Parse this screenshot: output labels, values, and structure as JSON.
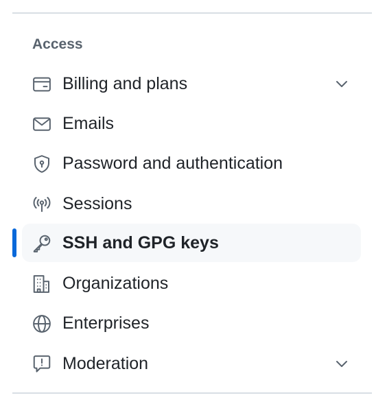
{
  "section": {
    "heading": "Access"
  },
  "nav": {
    "items": [
      {
        "label": "Billing and plans",
        "icon": "credit-card-icon",
        "has_chevron": true,
        "active": false
      },
      {
        "label": "Emails",
        "icon": "mail-icon",
        "has_chevron": false,
        "active": false
      },
      {
        "label": "Password and authentication",
        "icon": "shield-lock-icon",
        "has_chevron": false,
        "active": false
      },
      {
        "label": "Sessions",
        "icon": "broadcast-icon",
        "has_chevron": false,
        "active": false
      },
      {
        "label": "SSH and GPG keys",
        "icon": "key-icon",
        "has_chevron": false,
        "active": true
      },
      {
        "label": "Organizations",
        "icon": "organization-icon",
        "has_chevron": false,
        "active": false
      },
      {
        "label": "Enterprises",
        "icon": "globe-icon",
        "has_chevron": false,
        "active": false
      },
      {
        "label": "Moderation",
        "icon": "report-icon",
        "has_chevron": true,
        "active": false
      }
    ]
  },
  "colors": {
    "active_indicator": "#0969da",
    "active_background": "#f6f8fa",
    "text": "#1f2328",
    "muted_text": "#59636e",
    "divider": "#d8dee4"
  }
}
